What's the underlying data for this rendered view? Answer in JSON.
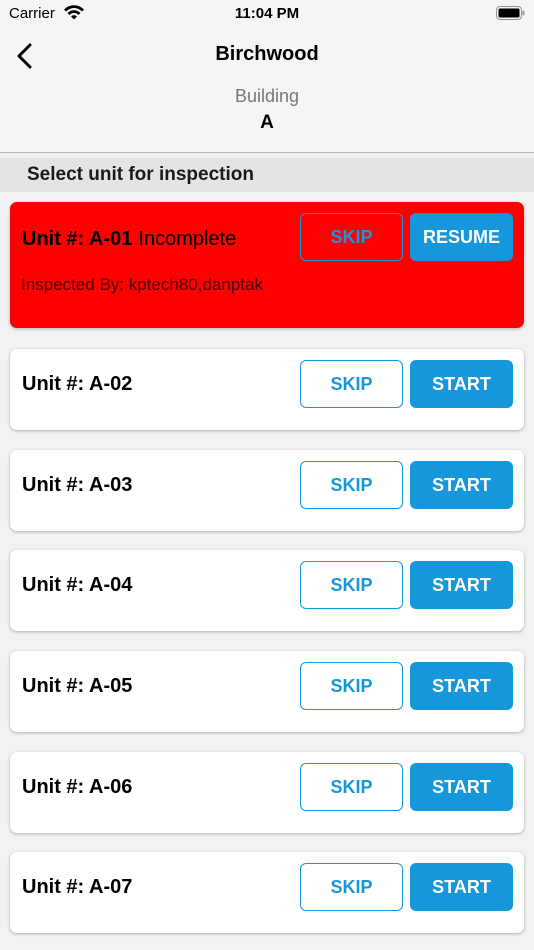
{
  "status_bar": {
    "carrier": "Carrier",
    "time": "11:04 PM"
  },
  "nav": {
    "title": "Birchwood",
    "building_label": "Building",
    "building_value": "A"
  },
  "section": {
    "header": "Select unit for inspection"
  },
  "units": [
    {
      "label": "Unit #: A-01",
      "status": "Incomplete",
      "inspected_by": "Inspected By: kptech80,danptak",
      "skip_label": "SKIP",
      "action_label": "RESUME"
    },
    {
      "label": "Unit #: A-02",
      "status": "",
      "inspected_by": "",
      "skip_label": "SKIP",
      "action_label": "START"
    },
    {
      "label": "Unit #: A-03",
      "status": "",
      "inspected_by": "",
      "skip_label": "SKIP",
      "action_label": "START"
    },
    {
      "label": "Unit #: A-04",
      "status": "",
      "inspected_by": "",
      "skip_label": "SKIP",
      "action_label": "START"
    },
    {
      "label": "Unit #: A-05",
      "status": "",
      "inspected_by": "",
      "skip_label": "SKIP",
      "action_label": "START"
    },
    {
      "label": "Unit #: A-06",
      "status": "",
      "inspected_by": "",
      "skip_label": "SKIP",
      "action_label": "START"
    },
    {
      "label": "Unit #: A-07",
      "status": "",
      "inspected_by": "",
      "skip_label": "SKIP",
      "action_label": "START"
    }
  ],
  "colors": {
    "accent": "#1697dc",
    "incomplete": "#ff0000"
  },
  "icons": {
    "back": "chevron-left-icon",
    "wifi": "wifi-icon",
    "battery": "battery-icon"
  }
}
